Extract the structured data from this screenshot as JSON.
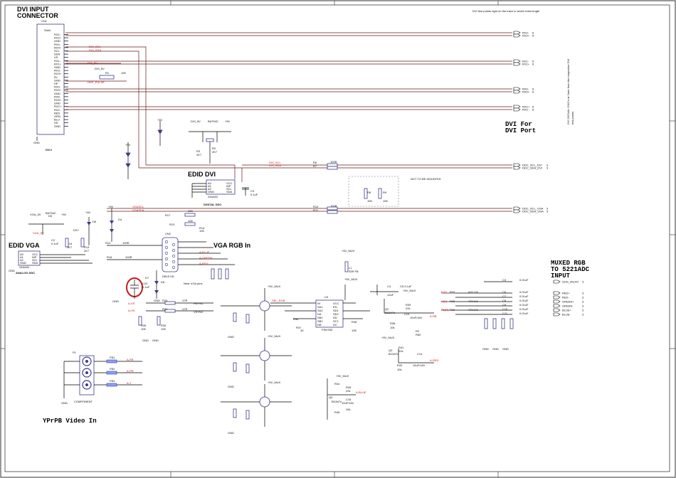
{
  "titles": {
    "dvi_input": [
      "DVI INPUT",
      "CONNECTOR"
    ],
    "dvi_port": [
      "DVI For",
      "DVI Port"
    ],
    "edid_dvi": "EDID DVI",
    "edid_vga": "EDID VGA",
    "vga_rgb_in": "VGA RGB In",
    "muxed_rgb": [
      "MUXED RGB",
      "TO 5221ADC",
      "INPUT"
    ],
    "ypbpr": "YPrPB Video In"
  },
  "notes": {
    "top_right": "DVI test points right on the trace to avoid extra length",
    "side": [
      "DVI SIGNAL GND's at 2mm from the respective DVI",
      "test points"
    ],
    "not_mounted": "NOT TO BE MOUNTED",
    "near_vga": "Near VGA pins"
  },
  "components": {
    "dvi_connector": {
      "ref": "CN1",
      "name": "DVI-I",
      "shell": "Shell"
    },
    "edid_dvi_ic": {
      "ref": "U5",
      "name": "DIGITAL DDC",
      "chip": "24AA02"
    },
    "edid_vga_ic": {
      "ref": "U4",
      "name": "ANALOG DDC",
      "chip": "24AA02"
    },
    "vga_connector": {
      "ref": "CN2",
      "name": "DB15 HD"
    },
    "mux_ic": {
      "ref": "U3",
      "name": "PI5V330"
    },
    "component_jack": {
      "ref": "P1",
      "name": "COMPONENT"
    }
  },
  "dvi_pins_left": [
    "RX2-",
    "RX2+",
    "GND",
    "RX4-",
    "RX4+",
    "SCL",
    "SDA",
    "VS",
    "RX1-",
    "RX1+",
    "GND",
    "RX3-",
    "RX3+",
    "5V",
    "GND",
    "HP",
    "RX0-",
    "RX0+",
    "GND",
    "RX5-",
    "RX5+",
    "GND",
    "RXC+",
    "RXC-",
    "RED",
    "GRN",
    "BLU",
    "HS",
    "GND"
  ],
  "nets": {
    "dvi_scl": "DVI_SCL",
    "dvi_sda": "DVI_SDA",
    "dvi_5v": "DVI_5V",
    "hdp": "HDP_PULSE",
    "vga_scl": "VGASCL",
    "vga_sda": "VGASDA",
    "ddc_scl_dvi": "DDC_SCL_DVI",
    "ddc_sda_dvi": "DDC_SDA_DVI",
    "ddc_scl_vga": "DDC_SCL_VGA",
    "ddc_sda_vga": "DDC_SDA_VGA",
    "vga_5v": "VGA_5V",
    "sog_muxo": "SOG_MUXO",
    "red_plus": "RED+",
    "red_minus": "RED-",
    "green_plus": "GREEN+",
    "green_minus": "GREEN-",
    "blue_plus": "BLUE+",
    "blue_minus": "BLUE-",
    "a_red": "A-RED",
    "a_green": "A-GREEN",
    "a_blue": "A-BLUE",
    "a_pb": "A-PB",
    "a_pr": "A-PR",
    "a_y": "A-Y"
  },
  "right_outputs": [
    {
      "label": "RX2-",
      "pin": "6"
    },
    {
      "label": "RX2+",
      "pin": "6"
    },
    {
      "label": "RX1-",
      "pin": "6"
    },
    {
      "label": "RX1+",
      "pin": "6"
    },
    {
      "label": "RX0-",
      "pin": "6"
    },
    {
      "label": "RX0+",
      "pin": "6"
    },
    {
      "label": "RXC+",
      "pin": "6"
    },
    {
      "label": "RXC-",
      "pin": "6"
    }
  ],
  "ddc_outputs": [
    {
      "label": "DDC_SCL_DVI",
      "pin": "3"
    },
    {
      "label": "DDC_SDA_DVI",
      "pin": "3"
    },
    {
      "label": "DDC_SCL_VGA",
      "pin": "3"
    },
    {
      "label": "DDC_SDA_VGA",
      "pin": "3"
    }
  ],
  "muxed_outputs": [
    {
      "label": "SOG_MUXO",
      "pin": "3"
    },
    {
      "label": "RED+",
      "pin": "3"
    },
    {
      "label": "RED-",
      "pin": "3"
    },
    {
      "label": "GREEN+",
      "pin": "3"
    },
    {
      "label": "GREEN-",
      "pin": "3"
    },
    {
      "label": "BLUE+",
      "pin": "3"
    },
    {
      "label": "BLUE-",
      "pin": "3"
    }
  ],
  "supplies": {
    "v5": "+5V",
    "v5mux": "+5V_MUX",
    "gnd": "GND",
    "dgnd": "DGND"
  }
}
